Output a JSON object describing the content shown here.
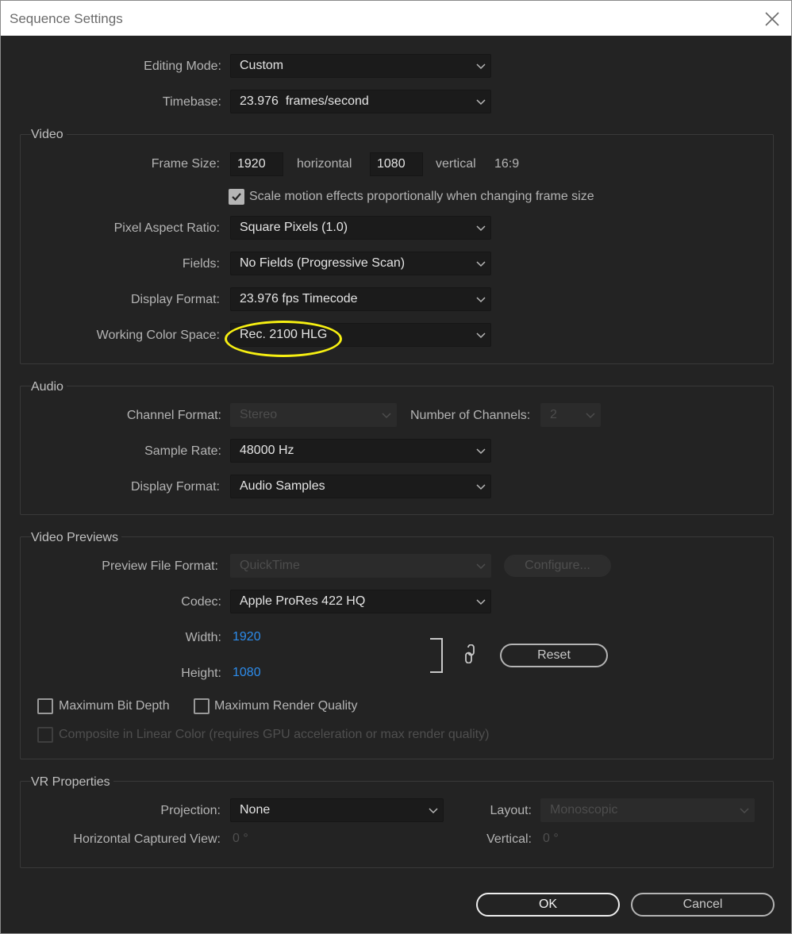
{
  "window": {
    "title": "Sequence Settings"
  },
  "editing_mode": {
    "label": "Editing Mode:",
    "value": "Custom"
  },
  "timebase": {
    "label": "Timebase:",
    "value": "23.976  frames/second"
  },
  "video": {
    "title": "Video",
    "frame_size_label": "Frame Size:",
    "width": "1920",
    "horizontal_label": "horizontal",
    "height": "1080",
    "vertical_label": "vertical",
    "aspect": "16:9",
    "scale_motion_label": "Scale motion effects proportionally when changing frame size",
    "scale_motion_checked": true,
    "par_label": "Pixel Aspect Ratio:",
    "par_value": "Square Pixels (1.0)",
    "fields_label": "Fields:",
    "fields_value": "No Fields (Progressive Scan)",
    "display_format_label": "Display Format:",
    "display_format_value": "23.976 fps Timecode",
    "wcs_label": "Working Color Space:",
    "wcs_value": "Rec. 2100 HLG"
  },
  "audio": {
    "title": "Audio",
    "channel_format_label": "Channel Format:",
    "channel_format_value": "Stereo",
    "num_channels_label": "Number of Channels:",
    "num_channels_value": "2",
    "sample_rate_label": "Sample Rate:",
    "sample_rate_value": "48000 Hz",
    "display_format_label": "Display Format:",
    "display_format_value": "Audio Samples"
  },
  "previews": {
    "title": "Video Previews",
    "file_format_label": "Preview File Format:",
    "file_format_value": "QuickTime",
    "configure_label": "Configure...",
    "codec_label": "Codec:",
    "codec_value": "Apple ProRes 422 HQ",
    "width_label": "Width:",
    "width_value": "1920",
    "height_label": "Height:",
    "height_value": "1080",
    "reset_label": "Reset",
    "max_bit_depth_label": "Maximum Bit Depth",
    "max_render_quality_label": "Maximum Render Quality",
    "composite_label": "Composite in Linear Color (requires GPU acceleration or max render quality)"
  },
  "vr": {
    "title": "VR Properties",
    "projection_label": "Projection:",
    "projection_value": "None",
    "layout_label": "Layout:",
    "layout_value": "Monoscopic",
    "h_view_label": "Horizontal Captured View:",
    "h_view_value": "0 °",
    "vertical_label": "Vertical:",
    "vertical_value": "0 °"
  },
  "footer": {
    "ok_label": "OK",
    "cancel_label": "Cancel"
  },
  "colors": {
    "highlight": "#f7f012",
    "link_blue": "#2d8ceb",
    "background": "#232323"
  }
}
